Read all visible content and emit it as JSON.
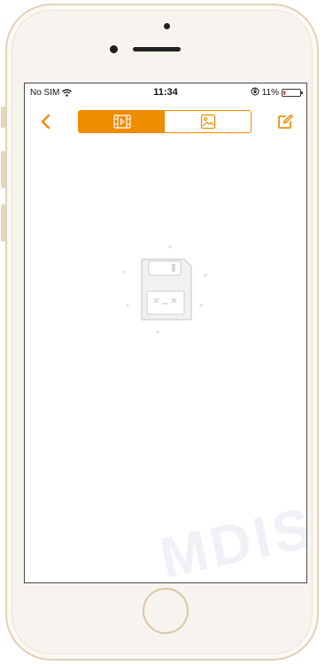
{
  "status_bar": {
    "carrier": "No SIM",
    "time": "11:34",
    "battery_text": "11%",
    "battery_level": 0.11
  },
  "nav_bar": {
    "back_icon": "chevron-left-icon",
    "segments": [
      {
        "icon": "video-film-icon",
        "active": true
      },
      {
        "icon": "image-photo-icon",
        "active": false
      }
    ],
    "edit_icon": "edit-compose-icon"
  },
  "content": {
    "empty_state_icon": "floppy-disk-empty-icon"
  },
  "watermark": "MDIS",
  "colors": {
    "accent": "#f08c00",
    "battery_low": "#e62e2e",
    "frame": "#e3d2b6"
  }
}
